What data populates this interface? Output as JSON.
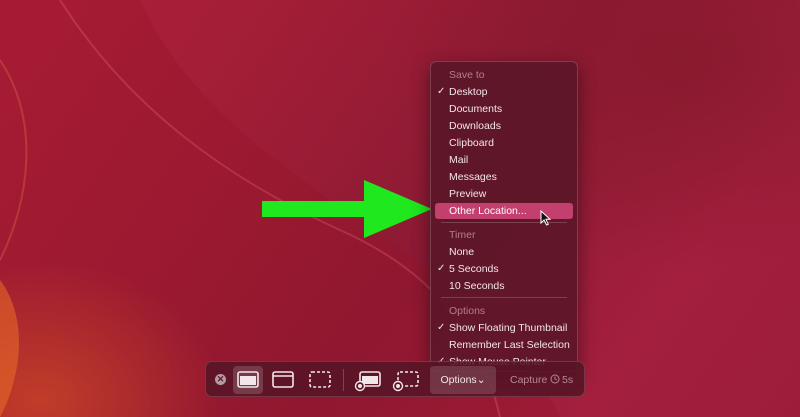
{
  "menu": {
    "sections": [
      {
        "header": "Save to",
        "items": [
          {
            "label": "Desktop",
            "checked": true
          },
          {
            "label": "Documents",
            "checked": false
          },
          {
            "label": "Downloads",
            "checked": false
          },
          {
            "label": "Clipboard",
            "checked": false
          },
          {
            "label": "Mail",
            "checked": false
          },
          {
            "label": "Messages",
            "checked": false
          },
          {
            "label": "Preview",
            "checked": false
          },
          {
            "label": "Other Location...",
            "checked": false,
            "highlighted": true
          }
        ]
      },
      {
        "header": "Timer",
        "items": [
          {
            "label": "None",
            "checked": false
          },
          {
            "label": "5 Seconds",
            "checked": true
          },
          {
            "label": "10 Seconds",
            "checked": false
          }
        ]
      },
      {
        "header": "Options",
        "items": [
          {
            "label": "Show Floating Thumbnail",
            "checked": true
          },
          {
            "label": "Remember Last Selection",
            "checked": false
          },
          {
            "label": "Show Mouse Pointer",
            "checked": true
          }
        ]
      }
    ],
    "check_glyph": "✓"
  },
  "toolbar": {
    "close_glyph": "✕",
    "options_label": "Options",
    "options_chevron": "⌄",
    "capture_label": "Capture",
    "timer_label": "5s",
    "buttons": [
      {
        "name": "capture-entire-screen-icon",
        "active": true
      },
      {
        "name": "capture-window-icon",
        "active": false
      },
      {
        "name": "capture-selection-icon",
        "active": false
      },
      {
        "name": "record-entire-screen-icon",
        "active": false
      },
      {
        "name": "record-selection-icon",
        "active": false
      }
    ]
  },
  "colors": {
    "highlight": "#c23f6e",
    "arrow": "#1fe81f"
  }
}
